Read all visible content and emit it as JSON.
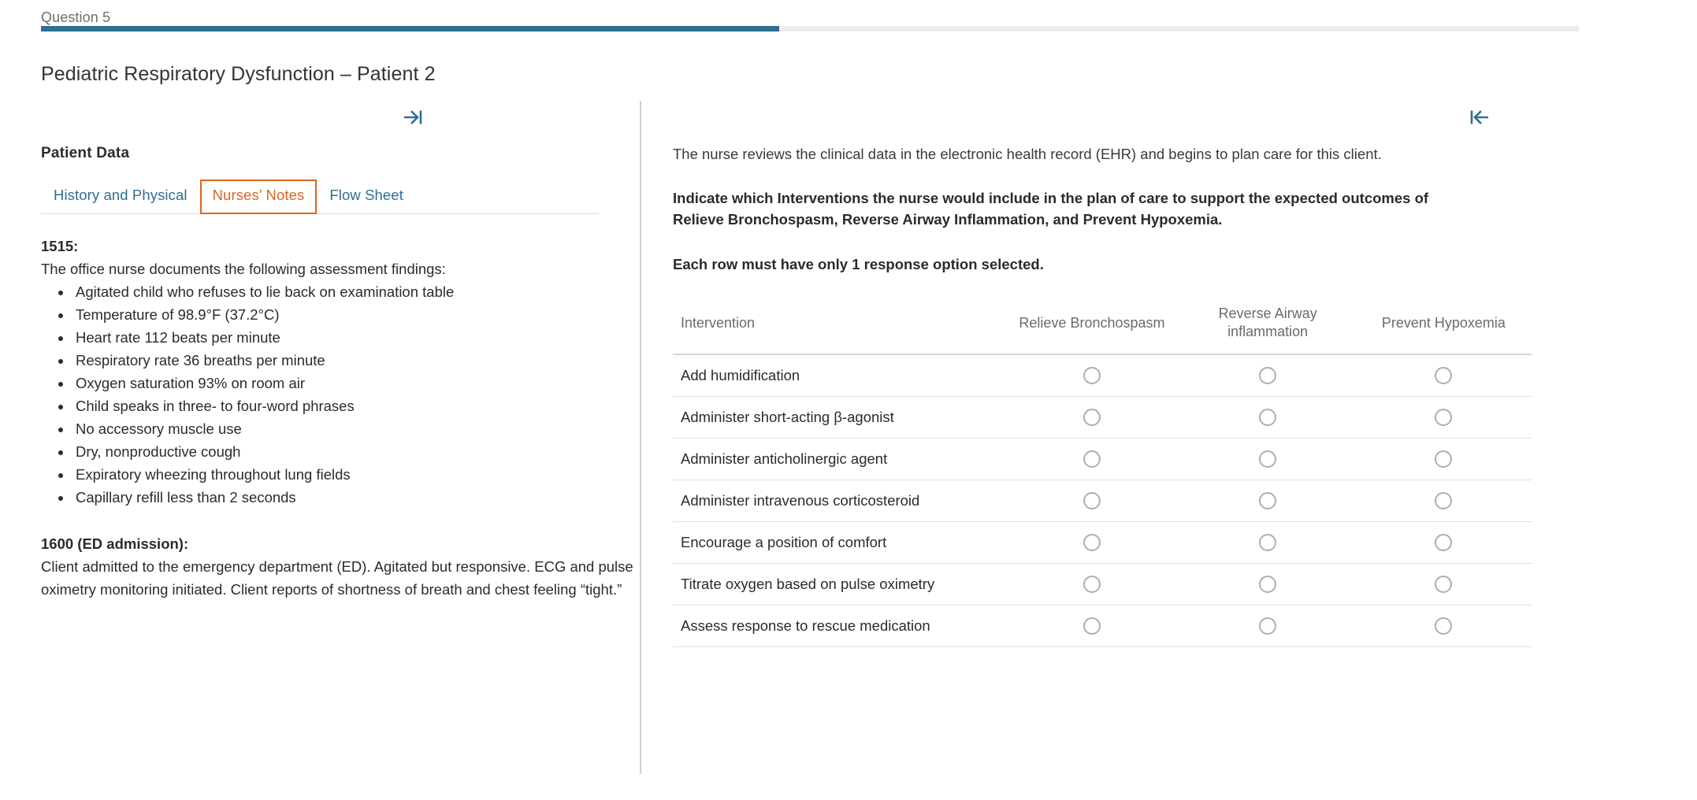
{
  "header": {
    "question_label": "Question 5",
    "progress_percent": 48,
    "progress_color": "#2e6f91",
    "track_color": "#ececec"
  },
  "case_title": "Pediatric Respiratory Dysfunction – Patient 2",
  "left_pane": {
    "collapse_icon": "arrow-right-to-bar-icon",
    "section_title": "Patient Data",
    "tabs": [
      {
        "label": "History and Physical",
        "active": false
      },
      {
        "label": "Nurses’ Notes",
        "active": true
      },
      {
        "label": "Flow Sheet",
        "active": false
      }
    ],
    "active_tab_color": "#d9661f",
    "tab_link_color": "#2e6f91",
    "notes": {
      "entry1_time": "1515:",
      "entry1_intro": "The office nurse documents the following assessment findings:",
      "entry1_findings": [
        "Agitated child who refuses to lie back on examination table",
        "Temperature of 98.9°F (37.2°C)",
        "Heart rate 112 beats per minute",
        "Respiratory rate 36 breaths per minute",
        "Oxygen saturation 93% on room air",
        "Child speaks in three- to four-word phrases",
        "No accessory muscle use",
        "Dry, nonproductive cough",
        "Expiratory wheezing throughout lung fields",
        "Capillary refill less than 2 seconds"
      ],
      "entry2_time": "1600 (ED admission):",
      "entry2_text": "Client admitted to the emergency department (ED). Agitated but responsive. ECG and pulse oximetry monitoring initiated. Client reports of shortness of breath and chest feeling “tight.”"
    }
  },
  "right_pane": {
    "collapse_icon": "bar-arrow-left-icon",
    "intro": "The nurse reviews the clinical data in the electronic health record (EHR) and begins to plan care for this client.",
    "prompt": "Indicate which Interventions the nurse would include in the plan of care to support the expected outcomes of Relieve Bronchospasm, Reverse Airway Inflammation, and Prevent Hypoxemia.",
    "rule": "Each row must have only 1 response option selected.",
    "table": {
      "columns": [
        "Intervention",
        "Relieve Bronchospasm",
        "Reverse Airway inflammation",
        "Prevent Hypoxemia"
      ],
      "rows": [
        {
          "intervention": "Add humidification",
          "selected": null
        },
        {
          "intervention": "Administer short-acting β-agonist",
          "selected": null
        },
        {
          "intervention": "Administer anticholinergic agent",
          "selected": null
        },
        {
          "intervention": "Administer intravenous corticosteroid",
          "selected": null
        },
        {
          "intervention": "Encourage a position of comfort",
          "selected": null
        },
        {
          "intervention": "Titrate oxygen based on pulse oximetry",
          "selected": null
        },
        {
          "intervention": "Assess response to rescue medication",
          "selected": null
        }
      ]
    }
  }
}
